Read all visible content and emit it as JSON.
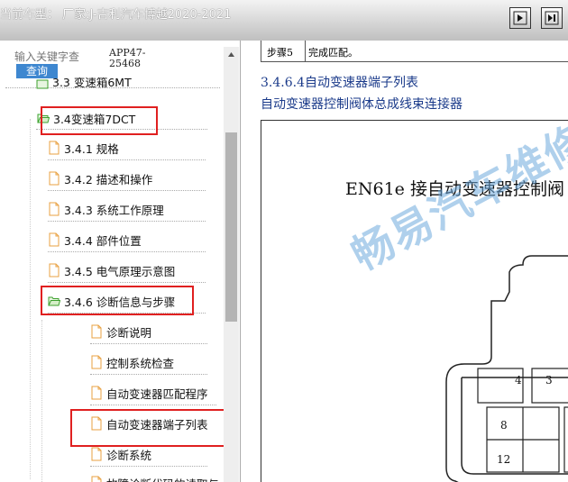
{
  "window": {
    "title": "当前车型： 厂家:J-吉利汽车博越2020-2021",
    "nav_buttons": [
      "play-icon",
      "skip-end-icon"
    ]
  },
  "sidebar": {
    "search_placeholder": "输入关键字查",
    "search_button": "查询",
    "app_id": "APP47-\n25468",
    "partial_item": "3.3 变速箱6MT",
    "tree": [
      {
        "label": "3.4变速箱7DCT",
        "icon": "folder-open-icon",
        "highlighted": true
      },
      {
        "label": "3.4.1 规格",
        "icon": "document-icon"
      },
      {
        "label": "3.4.2 描述和操作",
        "icon": "document-icon"
      },
      {
        "label": "3.4.3 系统工作原理",
        "icon": "document-icon"
      },
      {
        "label": "3.4.4 部件位置",
        "icon": "document-icon"
      },
      {
        "label": "3.4.5 电气原理示意图",
        "icon": "document-icon"
      },
      {
        "label": "3.4.6 诊断信息与步骤",
        "icon": "folder-open-icon",
        "highlighted": true
      },
      {
        "label": "诊断说明",
        "icon": "document-icon"
      },
      {
        "label": "控制系统检查",
        "icon": "document-icon"
      },
      {
        "label": "自动变速器匹配程序",
        "icon": "document-icon"
      },
      {
        "label": "自动变速器端子列表",
        "icon": "document-icon",
        "highlighted": true
      },
      {
        "label": "诊断系统",
        "icon": "document-icon"
      },
      {
        "label": "故障诊断代码的读取与",
        "icon": "document-icon"
      }
    ]
  },
  "content": {
    "step_table": {
      "step": "步骤5",
      "action": "完成匹配。"
    },
    "section_title": "3.4.6.4自动变速器端子列表",
    "section_subtitle": "自动变速器控制阀体总成线束连接器",
    "connector_title": "EN61e 接自动变速器控制阀",
    "watermark": "畅易汽车维修",
    "pins": [
      "4",
      "3",
      "8",
      "12"
    ]
  },
  "colors": {
    "highlight_box": "#e02020",
    "search_button": "#3e87d0",
    "heading_text": "#1a3a8a",
    "watermark": "#6eaadc"
  }
}
